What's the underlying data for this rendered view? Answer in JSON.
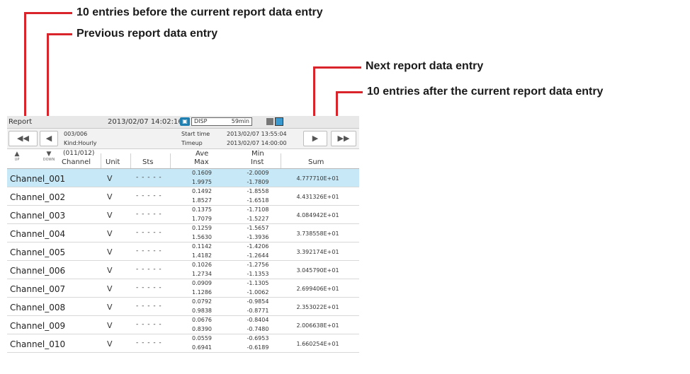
{
  "callouts": {
    "ten_before": "10 entries before the current report data entry",
    "previous": "Previous report data entry",
    "next": "Next report data entry",
    "ten_after": "10 entries after the current report data entry"
  },
  "status_bar": {
    "title": "Report",
    "datetime": "2013/02/07  14:02:16",
    "disp_label": "DISP",
    "disp_value": "59min"
  },
  "nav": {
    "first_icon": "double-left-arrow-icon",
    "prev_icon": "left-arrow-icon",
    "next_icon": "right-arrow-icon",
    "last_icon": "double-right-arrow-icon",
    "report_index": "003/006",
    "kind": "Kind:Hourly",
    "start_label": "Start time",
    "start_value": "2013/02/07  13:55:04",
    "timeup_label": "Timeup",
    "timeup_value": "2013/02/07  14:00:00"
  },
  "header": {
    "up_label": "UP",
    "down_label": "DOWN",
    "range": "(011/012)",
    "channel": "Channel",
    "unit": "Unit",
    "sts": "Sts",
    "ave": "Ave",
    "max": "Max",
    "min": "Min",
    "inst": "Inst",
    "sum": "Sum"
  },
  "rows": [
    {
      "channel": "Channel_001",
      "unit": "V",
      "sts": "- - - - -",
      "ave": "0.1609",
      "max": "1.9975",
      "min": "-2.0009",
      "inst": "-1.7809",
      "sum": "4.777710E+01"
    },
    {
      "channel": "Channel_002",
      "unit": "V",
      "sts": "- - - - -",
      "ave": "0.1492",
      "max": "1.8527",
      "min": "-1.8558",
      "inst": "-1.6518",
      "sum": "4.431326E+01"
    },
    {
      "channel": "Channel_003",
      "unit": "V",
      "sts": "- - - - -",
      "ave": "0.1375",
      "max": "1.7079",
      "min": "-1.7108",
      "inst": "-1.5227",
      "sum": "4.084942E+01"
    },
    {
      "channel": "Channel_004",
      "unit": "V",
      "sts": "- - - - -",
      "ave": "0.1259",
      "max": "1.5630",
      "min": "-1.5657",
      "inst": "-1.3936",
      "sum": "3.738558E+01"
    },
    {
      "channel": "Channel_005",
      "unit": "V",
      "sts": "- - - - -",
      "ave": "0.1142",
      "max": "1.4182",
      "min": "-1.4206",
      "inst": "-1.2644",
      "sum": "3.392174E+01"
    },
    {
      "channel": "Channel_006",
      "unit": "V",
      "sts": "- - - - -",
      "ave": "0.1026",
      "max": "1.2734",
      "min": "-1.2756",
      "inst": "-1.1353",
      "sum": "3.045790E+01"
    },
    {
      "channel": "Channel_007",
      "unit": "V",
      "sts": "- - - - -",
      "ave": "0.0909",
      "max": "1.1286",
      "min": "-1.1305",
      "inst": "-1.0062",
      "sum": "2.699406E+01"
    },
    {
      "channel": "Channel_008",
      "unit": "V",
      "sts": "- - - - -",
      "ave": "0.0792",
      "max": "0.9838",
      "min": "-0.9854",
      "inst": "-0.8771",
      "sum": "2.353022E+01"
    },
    {
      "channel": "Channel_009",
      "unit": "V",
      "sts": "- - - - -",
      "ave": "0.0676",
      "max": "0.8390",
      "min": "-0.8404",
      "inst": "-0.7480",
      "sum": "2.006638E+01"
    },
    {
      "channel": "Channel_010",
      "unit": "V",
      "sts": "- - - - -",
      "ave": "0.0559",
      "max": "0.6941",
      "min": "-0.6953",
      "inst": "-0.6189",
      "sum": "1.660254E+01"
    }
  ],
  "colors": {
    "callout_red": "#d8242a",
    "selected_row": "#c7e8f6"
  }
}
